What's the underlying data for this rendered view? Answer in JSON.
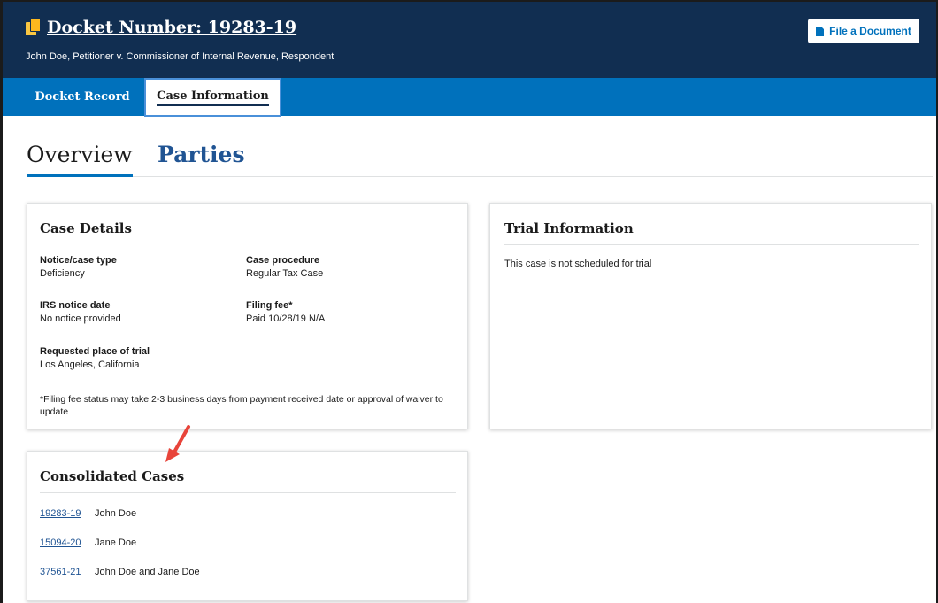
{
  "header": {
    "docket_title": "Docket Number: 19283-19",
    "caption": "John Doe, Petitioner v. Commissioner of Internal Revenue, Respondent",
    "file_button": "File a Document"
  },
  "tabs": [
    {
      "label": "Docket Record",
      "active": false
    },
    {
      "label": "Case Information",
      "active": true
    }
  ],
  "subtabs": [
    {
      "label": "Overview",
      "active": true
    },
    {
      "label": "Parties",
      "active": false
    }
  ],
  "case_details": {
    "title": "Case Details",
    "fields": {
      "notice_type": {
        "label": "Notice/case type",
        "value": "Deficiency"
      },
      "procedure": {
        "label": "Case procedure",
        "value": "Regular Tax Case"
      },
      "irs_notice": {
        "label": "IRS notice date",
        "value": "No notice provided"
      },
      "filing_fee": {
        "label": "Filing fee*",
        "value": "Paid 10/28/19 N/A"
      },
      "place_of_trial": {
        "label": "Requested place of trial",
        "value": "Los Angeles, California"
      }
    },
    "footnote": "*Filing fee status may take 2-3 business days from payment received date or approval of waiver to update"
  },
  "trial_information": {
    "title": "Trial Information",
    "text": "This case is not scheduled for trial"
  },
  "consolidated_cases": {
    "title": "Consolidated Cases",
    "rows": [
      {
        "docket": "19283-19",
        "name": "John Doe"
      },
      {
        "docket": "15094-20",
        "name": "Jane Doe"
      },
      {
        "docket": "37561-21",
        "name": "John Doe and Jane Doe"
      }
    ]
  },
  "colors": {
    "header_bg": "#112e51",
    "tabbar_bg": "#0071bc",
    "link": "#205493",
    "accent_yellow": "#fdb81e",
    "annotation_arrow": "#e8443a"
  },
  "icons": {
    "docket": "folder-copy-icon",
    "file_button": "file-icon",
    "annotation": "red-arrow-icon"
  }
}
